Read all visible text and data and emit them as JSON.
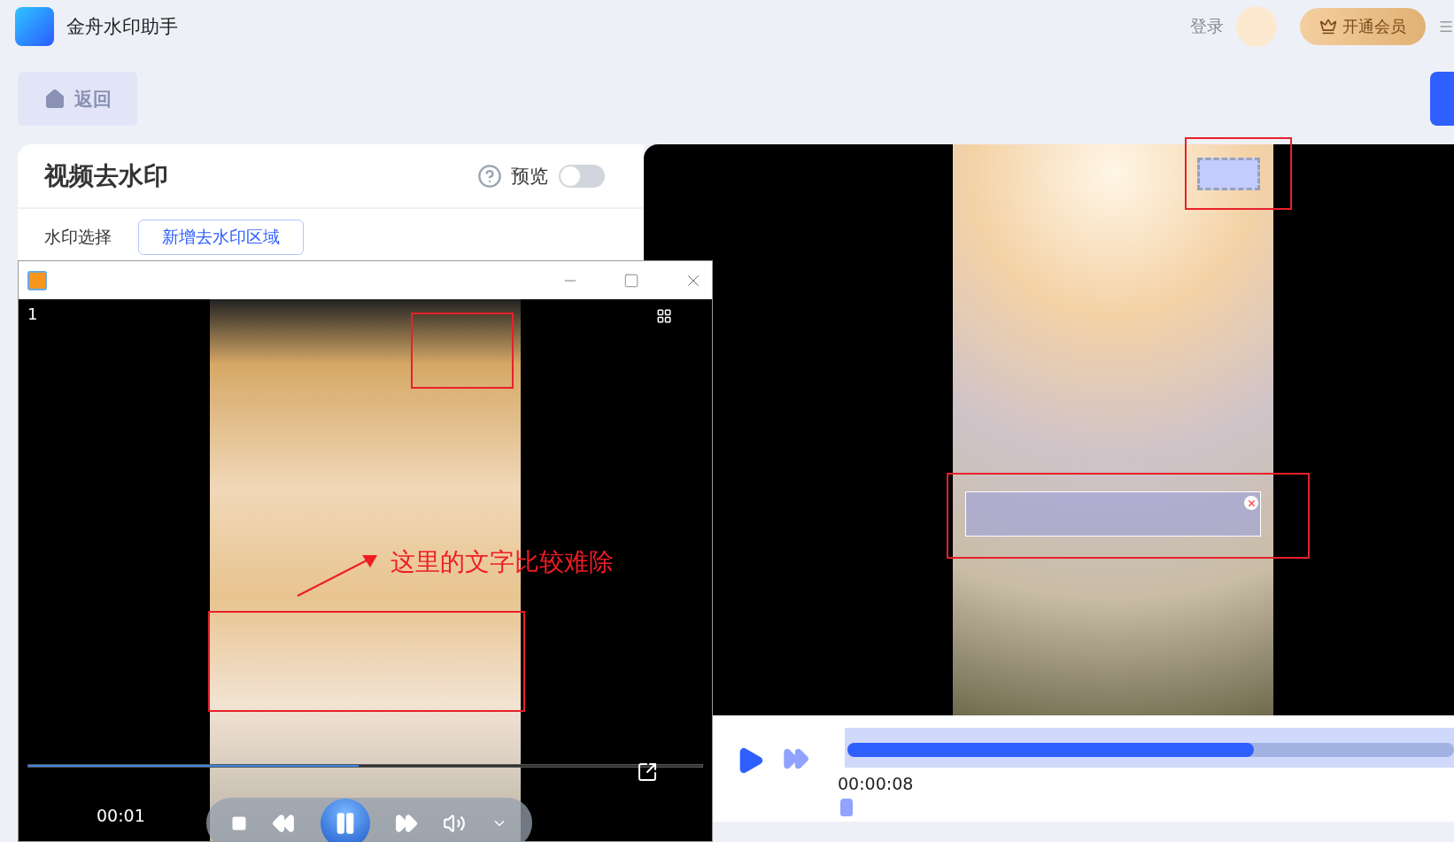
{
  "app": {
    "title": "金舟水印助手"
  },
  "header": {
    "login": "登录",
    "vip_button": "开通会员"
  },
  "back_button": "返回",
  "panel": {
    "title": "视频去水印",
    "preview_label": "预览",
    "preview_on": false,
    "watermark_label": "水印选择",
    "add_region_button": "新增去水印区域"
  },
  "player": {
    "time": "00:00:08",
    "level": 0.67
  },
  "media_window": {
    "index": "1",
    "time": "00:01",
    "level": 0.49,
    "annotation": "这里的文字比较难除"
  }
}
